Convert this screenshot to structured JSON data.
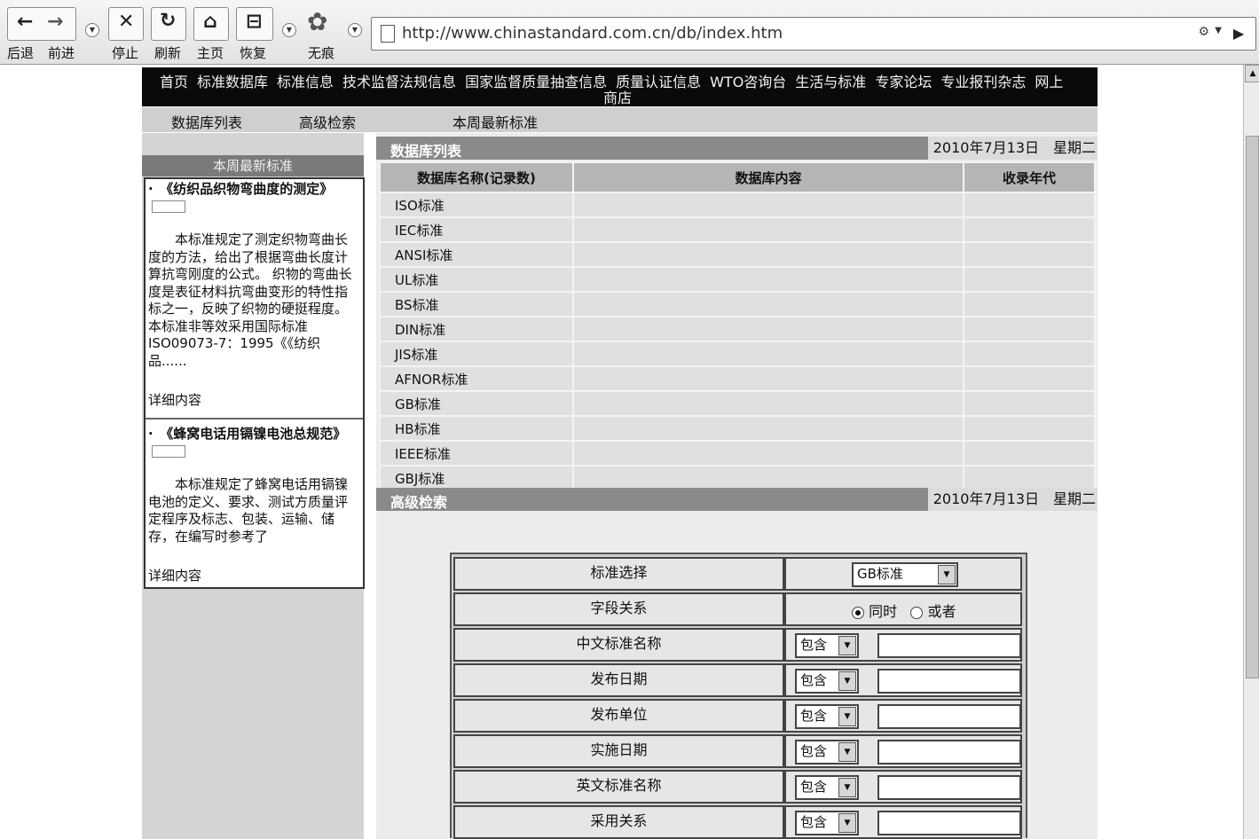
{
  "browser": {
    "buttons": {
      "back": "后退",
      "forward": "前进",
      "stop": "停止",
      "refresh": "刷新",
      "home": "主页",
      "restore": "恢复",
      "incognito": "无痕"
    },
    "url": "http://www.chinastandard.com.cn/db/index.htm"
  },
  "topnav": {
    "items": [
      "首页",
      "标准数据库",
      "标准信息",
      "技术监督法规信息",
      "国家监督质量抽查信息",
      "质量认证信息",
      "WTO咨询台",
      "生活与标准",
      "专家论坛",
      "专业报刊杂志",
      "网上"
    ],
    "wrap": "商店"
  },
  "subnav": {
    "db_list": "数据库列表",
    "advanced": "高级检索",
    "weekly": "本周最新标准"
  },
  "sidebar": {
    "header": "本周最新标准",
    "articles": [
      {
        "title": "·　《纺织品织物弯曲度的测定》",
        "body": "本标准规定了测定织物弯曲长度的方法，给出了根据弯曲长度计算抗弯刚度的公式。 织物的弯曲长度是表征材料抗弯曲变形的特性指标之一，反映了织物的硬挺程度。本标准非等效采用国际标准ISO09073-7：1995《《纺织品......",
        "more": "详细内容"
      },
      {
        "title": "·　《蜂窝电话用镉镍电池总规范》",
        "body": "本标准规定了蜂窝电话用镉镍电池的定义、要求、测试方质量评定程序及标志、包装、运输、储存，在编写时参考了",
        "more": "详细内容"
      }
    ]
  },
  "db_section": {
    "title": "数据库列表",
    "date": "2010年7月13日　星期二",
    "columns": [
      "数据库名称(记录数)",
      "数据库内容",
      "收录年代"
    ],
    "rows": [
      "ISO标准",
      "IEC标准",
      "ANSI标准",
      "UL标准",
      "BS标准",
      "DIN标准",
      "JIS标准",
      "AFNOR标准",
      "GB标准",
      "HB标准",
      "IEEE标准",
      "GBJ标准"
    ]
  },
  "search_section": {
    "title": "高级检索",
    "date": "2010年7月13日　星期二",
    "standard_label": "标准选择",
    "standard_value": "GB标准",
    "relation_label": "字段关系",
    "radio_and": "同时",
    "radio_or": "或者",
    "fields": [
      {
        "label": "中文标准名称",
        "op": "包含"
      },
      {
        "label": "发布日期",
        "op": "包含"
      },
      {
        "label": "发布单位",
        "op": "包含"
      },
      {
        "label": "实施日期",
        "op": "包含"
      },
      {
        "label": "英文标准名称",
        "op": "包含"
      },
      {
        "label": "采用关系",
        "op": "包含"
      }
    ]
  }
}
